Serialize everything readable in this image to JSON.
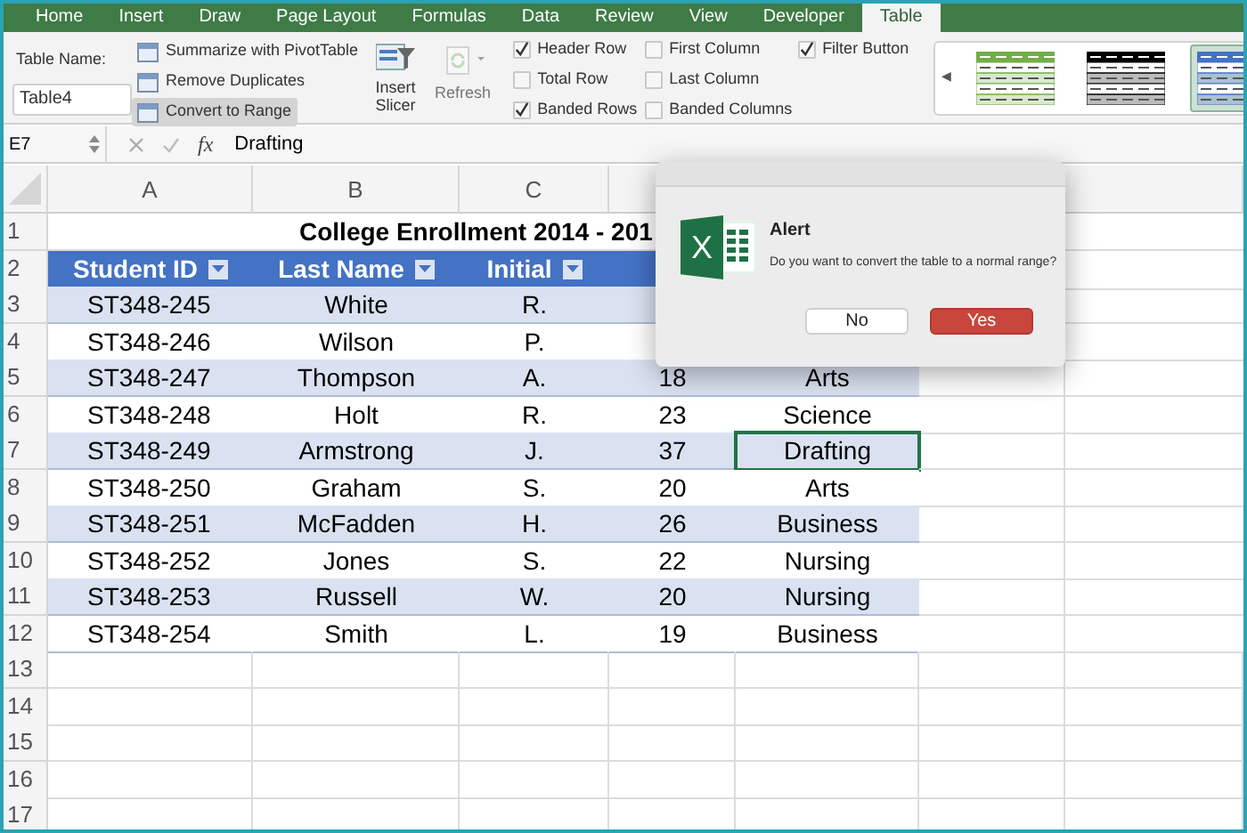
{
  "tabs": [
    {
      "label": "Home",
      "selected": false
    },
    {
      "label": "Insert",
      "selected": false
    },
    {
      "label": "Draw",
      "selected": false
    },
    {
      "label": "Page Layout",
      "selected": false
    },
    {
      "label": "Formulas",
      "selected": false
    },
    {
      "label": "Data",
      "selected": false
    },
    {
      "label": "Review",
      "selected": false
    },
    {
      "label": "View",
      "selected": false
    },
    {
      "label": "Developer",
      "selected": false
    },
    {
      "label": "Table",
      "selected": true
    }
  ],
  "ribbon": {
    "table_name_label": "Table Name:",
    "table_name": "Table4",
    "tools": [
      {
        "label": "Summarize with PivotTable",
        "pressed": false
      },
      {
        "label": "Remove Duplicates",
        "pressed": false
      },
      {
        "label": "Convert to Range",
        "pressed": true
      }
    ],
    "insert_slicer": "Insert Slicer",
    "refresh": {
      "label": "Refresh",
      "disabled": true
    },
    "options": [
      {
        "label": "Header Row",
        "checked": true
      },
      {
        "label": "Total Row",
        "checked": false
      },
      {
        "label": "Banded Rows",
        "checked": true
      },
      {
        "label": "First Column",
        "checked": false
      },
      {
        "label": "Last Column",
        "checked": false
      },
      {
        "label": "Banded Columns",
        "checked": false
      },
      {
        "label": "Filter Button",
        "checked": true
      }
    ],
    "gallery_prev": "◀",
    "styles": [
      {
        "color": "#70ad47",
        "selected": false
      },
      {
        "color": "#000000",
        "selected": false
      },
      {
        "color": "#4472c4",
        "selected": true
      }
    ]
  },
  "formula_bar": {
    "name_box": "E7",
    "function_label": "fx",
    "value": "Drafting"
  },
  "sheet": {
    "columns": [
      "A",
      "B",
      "C"
    ],
    "row_labels": [
      "1",
      "2",
      "3",
      "4",
      "5",
      "6",
      "7",
      "8",
      "9",
      "10",
      "11",
      "12",
      "13",
      "14",
      "15",
      "16",
      "17"
    ],
    "title": "College Enrollment 2014 - 201",
    "headers": [
      "Student ID",
      "Last Name",
      "Initial"
    ],
    "rows": [
      {
        "cells": [
          {
            "text": "ST348-245",
            "selected": false
          },
          {
            "text": "White",
            "selected": false
          },
          {
            "text": "R.",
            "selected": false
          }
        ]
      },
      {
        "cells": [
          {
            "text": "ST348-246",
            "selected": false
          },
          {
            "text": "Wilson",
            "selected": false
          },
          {
            "text": "P.",
            "selected": false
          }
        ]
      },
      {
        "cells": [
          {
            "text": "ST348-247",
            "selected": false
          },
          {
            "text": "Thompson",
            "selected": false
          },
          {
            "text": "A.",
            "selected": false
          },
          {
            "text": "18",
            "selected": false
          },
          {
            "text": "Arts",
            "selected": false
          }
        ]
      },
      {
        "cells": [
          {
            "text": "ST348-248",
            "selected": false
          },
          {
            "text": "Holt",
            "selected": false
          },
          {
            "text": "R.",
            "selected": false
          },
          {
            "text": "23",
            "selected": false
          },
          {
            "text": "Science",
            "selected": false
          }
        ]
      },
      {
        "cells": [
          {
            "text": "ST348-249",
            "selected": false
          },
          {
            "text": "Armstrong",
            "selected": false
          },
          {
            "text": "J.",
            "selected": false
          },
          {
            "text": "37",
            "selected": false
          },
          {
            "text": "Drafting",
            "selected": true
          }
        ]
      },
      {
        "cells": [
          {
            "text": "ST348-250",
            "selected": false
          },
          {
            "text": "Graham",
            "selected": false
          },
          {
            "text": "S.",
            "selected": false
          },
          {
            "text": "20",
            "selected": false
          },
          {
            "text": "Arts",
            "selected": false
          }
        ]
      },
      {
        "cells": [
          {
            "text": "ST348-251",
            "selected": false
          },
          {
            "text": "McFadden",
            "selected": false
          },
          {
            "text": "H.",
            "selected": false
          },
          {
            "text": "26",
            "selected": false
          },
          {
            "text": "Business",
            "selected": false
          }
        ]
      },
      {
        "cells": [
          {
            "text": "ST348-252",
            "selected": false
          },
          {
            "text": "Jones",
            "selected": false
          },
          {
            "text": "S.",
            "selected": false
          },
          {
            "text": "22",
            "selected": false
          },
          {
            "text": "Nursing",
            "selected": false
          }
        ]
      },
      {
        "cells": [
          {
            "text": "ST348-253",
            "selected": false
          },
          {
            "text": "Russell",
            "selected": false
          },
          {
            "text": "W.",
            "selected": false
          },
          {
            "text": "20",
            "selected": false
          },
          {
            "text": "Nursing",
            "selected": false
          }
        ]
      },
      {
        "cells": [
          {
            "text": "ST348-254",
            "selected": false
          },
          {
            "text": "Smith",
            "selected": false
          },
          {
            "text": "L.",
            "selected": false
          },
          {
            "text": "19",
            "selected": false
          },
          {
            "text": "Business",
            "selected": false
          }
        ]
      }
    ]
  },
  "dialog": {
    "icon_letter": "X",
    "title": "Alert",
    "message": "Do you want to convert the table to a normal range?",
    "buttons": [
      {
        "label": "No",
        "default": false
      },
      {
        "label": "Yes",
        "default": true
      }
    ]
  }
}
